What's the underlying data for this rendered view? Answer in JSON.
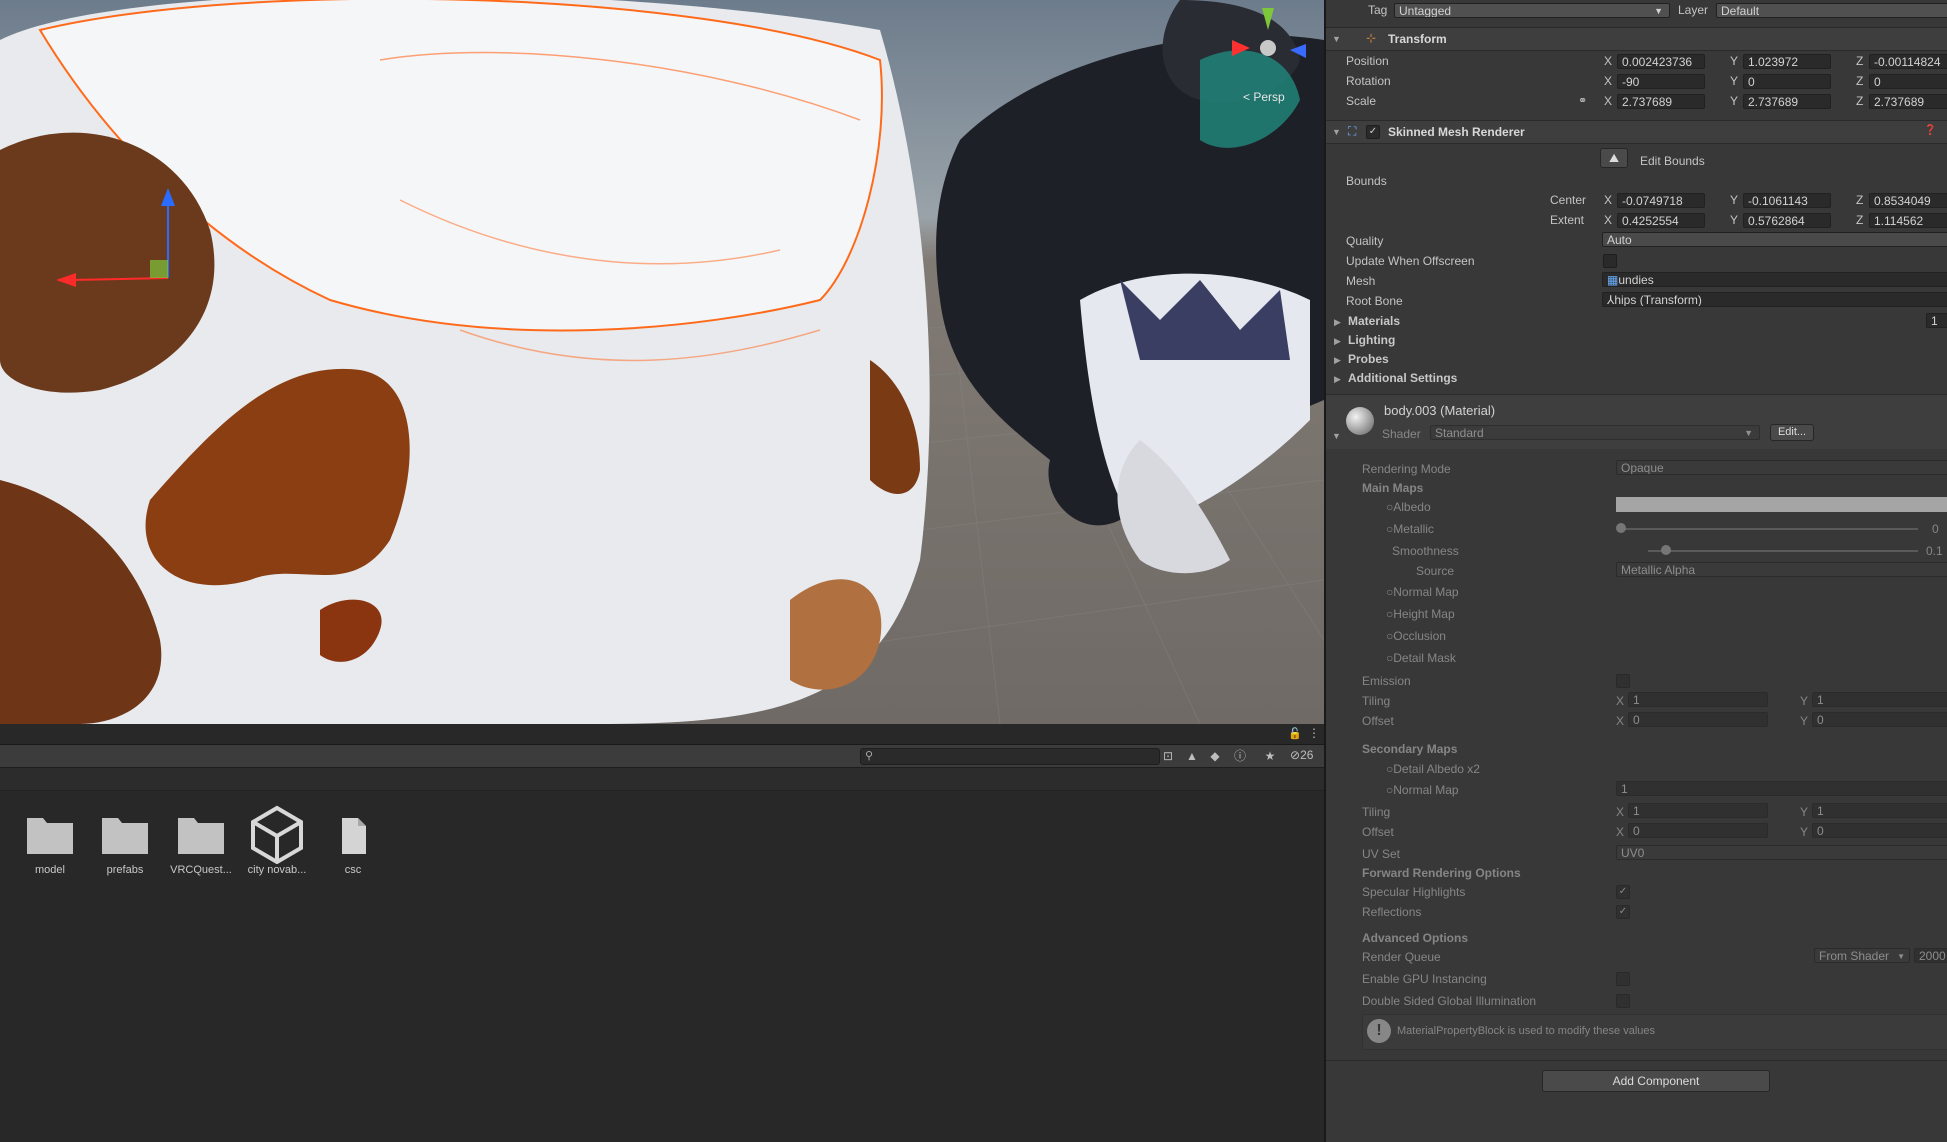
{
  "scene": {
    "camera_mode": "Persp"
  },
  "project": {
    "hidden_count": "26",
    "assets": [
      {
        "name": "model",
        "icon": "folder-icon"
      },
      {
        "name": "prefabs",
        "icon": "folder-icon"
      },
      {
        "name": "VRCQuest...",
        "icon": "folder-icon"
      },
      {
        "name": "city novab...",
        "icon": "unity-prefab-icon"
      },
      {
        "name": "csc",
        "icon": "file-icon"
      }
    ]
  },
  "inspector": {
    "tag_label": "Tag",
    "tag_value": "Untagged",
    "layer_label": "Layer",
    "layer_value": "Default",
    "transform": {
      "title": "Transform",
      "position_label": "Position",
      "position": {
        "x": "0.002423736",
        "y": "1.023972",
        "z": "-0.00114824"
      },
      "rotation_label": "Rotation",
      "rotation": {
        "x": "-90",
        "y": "0",
        "z": "0"
      },
      "scale_label": "Scale",
      "scale": {
        "x": "2.737689",
        "y": "2.737689",
        "z": "2.737689"
      }
    },
    "smr": {
      "title": "Skinned Mesh Renderer",
      "edit_bounds": "Edit Bounds",
      "bounds_label": "Bounds",
      "center_label": "Center",
      "center": {
        "x": "-0.0749718",
        "y": "-0.1061143",
        "z": "0.8534049"
      },
      "extent_label": "Extent",
      "extent": {
        "x": "0.4252554",
        "y": "0.5762864",
        "z": "1.114562"
      },
      "quality_label": "Quality",
      "quality": "Auto",
      "update_offscreen_label": "Update When Offscreen",
      "mesh_label": "Mesh",
      "mesh": "undies",
      "root_bone_label": "Root Bone",
      "root_bone": "hips (Transform)",
      "materials_label": "Materials",
      "materials_count": "1",
      "lighting_label": "Lighting",
      "probes_label": "Probes",
      "additional_label": "Additional Settings"
    },
    "material": {
      "name": "body.003 (Material)",
      "shader_label": "Shader",
      "shader": "Standard",
      "edit_btn": "Edit...",
      "rendering_mode_label": "Rendering Mode",
      "rendering_mode": "Opaque",
      "main_maps": "Main Maps",
      "albedo": "Albedo",
      "metallic": "Metallic",
      "metallic_val": "0",
      "smoothness": "Smoothness",
      "smoothness_val": "0.1",
      "source": "Source",
      "source_val": "Metallic Alpha",
      "normal_map": "Normal Map",
      "height_map": "Height Map",
      "occlusion": "Occlusion",
      "detail_mask": "Detail Mask",
      "emission": "Emission",
      "tiling": "Tiling",
      "tiling_x": "1",
      "tiling_y": "1",
      "offset": "Offset",
      "offset_x": "0",
      "offset_y": "0",
      "secondary_maps": "Secondary Maps",
      "detail_albedo": "Detail Albedo x2",
      "normal_map2": "Normal Map",
      "normal_map2_val": "1",
      "tiling2_x": "1",
      "tiling2_y": "1",
      "offset2_x": "0",
      "offset2_y": "0",
      "uv_set_label": "UV Set",
      "uv_set": "UV0",
      "forward_options": "Forward Rendering Options",
      "specular": "Specular Highlights",
      "reflections": "Reflections",
      "advanced": "Advanced Options",
      "render_queue": "Render Queue",
      "render_queue_mode": "From Shader",
      "render_queue_val": "2000",
      "gpu_instancing": "Enable GPU Instancing",
      "double_sided": "Double Sided Global Illumination",
      "mpb_notice": "MaterialPropertyBlock is used to modify these values"
    },
    "add_component": "Add Component"
  }
}
